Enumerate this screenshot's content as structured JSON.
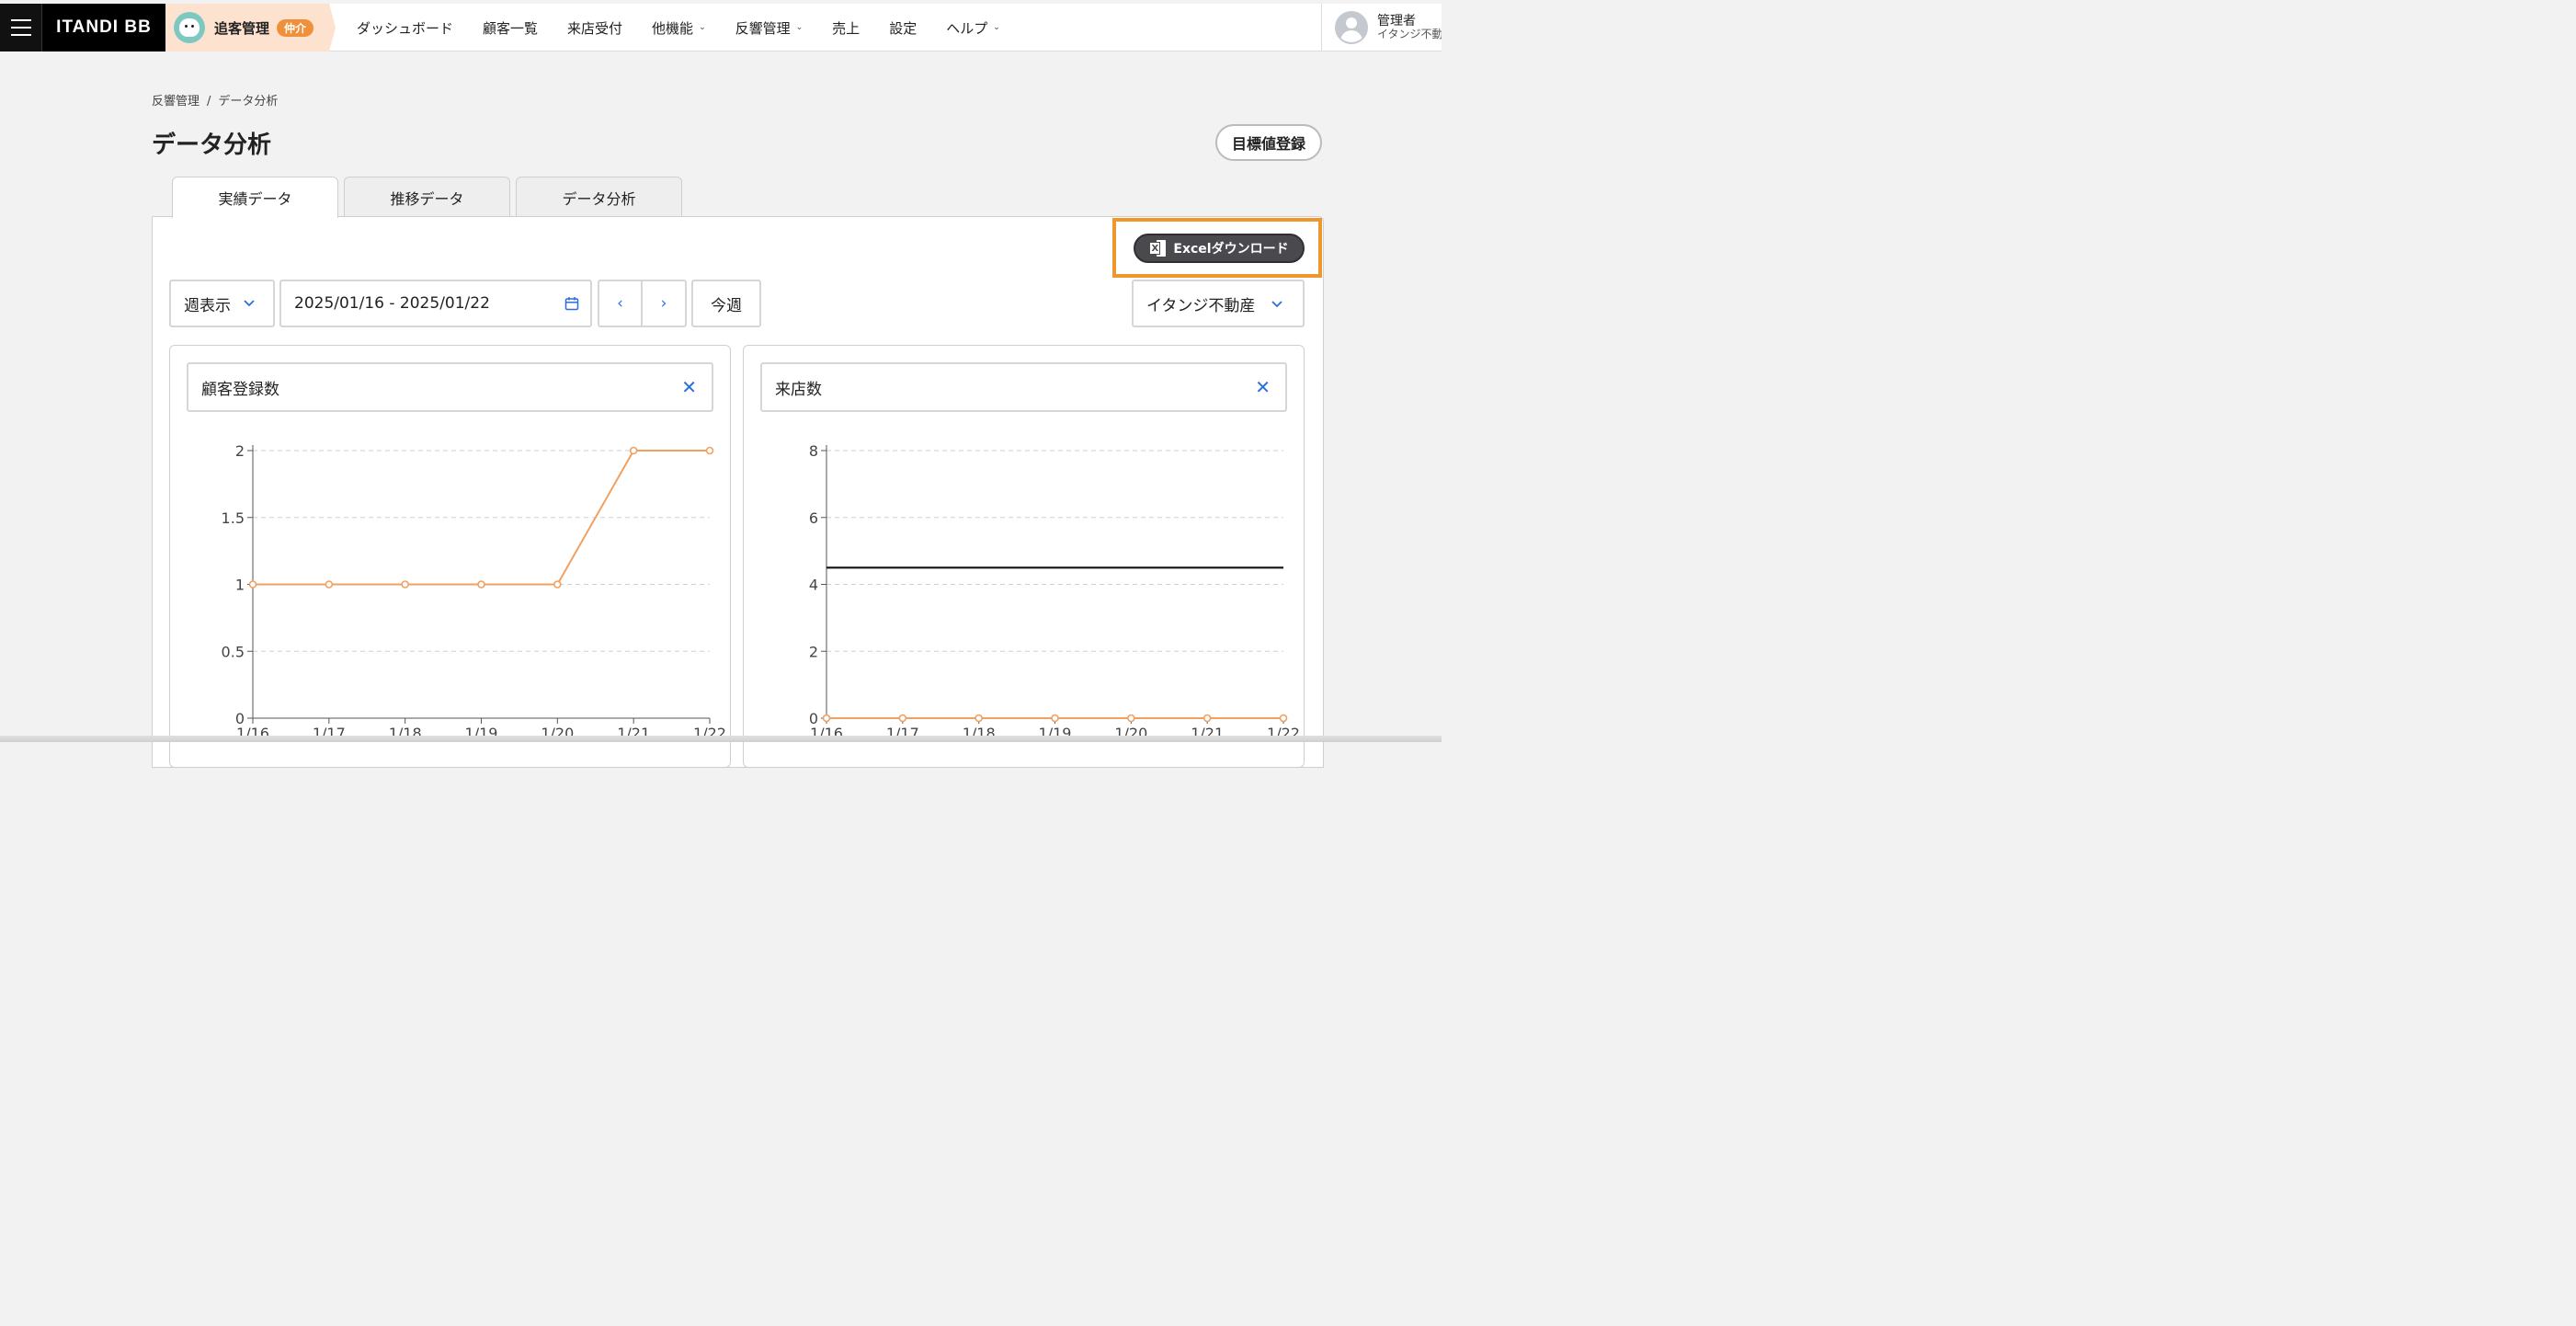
{
  "topbar": {
    "logo": "ITANDI BB",
    "product_name": "追客管理",
    "product_badge": "仲介",
    "nav": [
      {
        "label": "ダッシュボード",
        "dropdown": false
      },
      {
        "label": "顧客一覧",
        "dropdown": false
      },
      {
        "label": "来店受付",
        "dropdown": false
      },
      {
        "label": "他機能",
        "dropdown": true
      },
      {
        "label": "反響管理",
        "dropdown": true
      },
      {
        "label": "売上",
        "dropdown": false
      },
      {
        "label": "設定",
        "dropdown": false
      },
      {
        "label": "ヘルプ",
        "dropdown": true
      }
    ],
    "user_name": "管理者",
    "user_org": "イタンジ不動産"
  },
  "breadcrumb": {
    "parent": "反響管理",
    "separator": "/",
    "current": "データ分析"
  },
  "page": {
    "title": "データ分析",
    "goal_button": "目標値登録"
  },
  "tabs": [
    {
      "label": "実績データ",
      "active": true
    },
    {
      "label": "推移データ",
      "active": false
    },
    {
      "label": "データ分析",
      "active": false
    }
  ],
  "toolbar": {
    "excel_button": "Excelダウンロード",
    "period_select": "週表示",
    "date_range": "2025/01/16 - 2025/01/22",
    "prev": "‹",
    "next": "›",
    "this_week": "今週",
    "store_select": "イタンジ不動産"
  },
  "icons": {
    "calendar": "calendar-icon",
    "clear": "close-icon",
    "chevron": "chevron-down-icon",
    "excel": "excel-icon"
  },
  "colors": {
    "series": "#f0a060",
    "target_line": "#111111",
    "accent": "#f0962e",
    "link": "#2a6fdb"
  },
  "chart_data": [
    {
      "type": "line",
      "title": "顧客登録数",
      "x": [
        "1/16",
        "1/17",
        "1/18",
        "1/19",
        "1/20",
        "1/21",
        "1/22"
      ],
      "series": [
        {
          "values": [
            1,
            1,
            1,
            1,
            1,
            2,
            2
          ]
        }
      ],
      "yticks": [
        "0",
        "0.5",
        "1",
        "1.5",
        "2"
      ],
      "ylim": [
        0,
        2
      ],
      "grid": true
    },
    {
      "type": "line",
      "title": "来店数",
      "x": [
        "1/16",
        "1/17",
        "1/18",
        "1/19",
        "1/20",
        "1/21",
        "1/22"
      ],
      "series": [
        {
          "values": [
            0,
            0,
            0,
            0,
            0,
            0,
            0
          ]
        }
      ],
      "reference_line": 4.5,
      "yticks": [
        "0",
        "2",
        "4",
        "6",
        "8"
      ],
      "ylim": [
        0,
        8
      ],
      "grid": true
    }
  ]
}
